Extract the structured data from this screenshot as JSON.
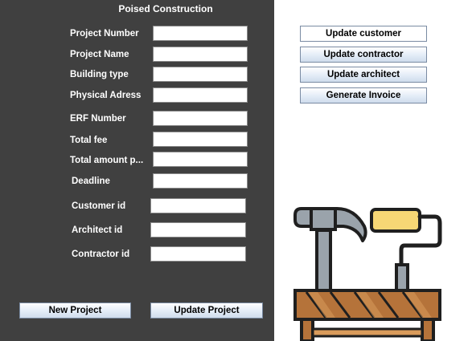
{
  "app": {
    "title": "Poised Construction"
  },
  "form": {
    "fields": [
      {
        "label": "Project Number",
        "value": ""
      },
      {
        "label": "Project Name",
        "value": ""
      },
      {
        "label": "Building type",
        "value": ""
      },
      {
        "label": "Physical Adress",
        "value": ""
      },
      {
        "label": "ERF Number",
        "value": ""
      },
      {
        "label": "Total fee",
        "value": ""
      },
      {
        "label": "Total amount p...",
        "value": ""
      },
      {
        "label": "Deadline",
        "value": ""
      },
      {
        "label": "Customer id",
        "value": ""
      },
      {
        "label": "Architect id",
        "value": ""
      },
      {
        "label": "Contractor id",
        "value": ""
      }
    ]
  },
  "actions": {
    "update_customer": "Update customer",
    "update_contractor": "Update contractor",
    "update_architect": "Update  architect",
    "generate_invoice": "Generate Invoice",
    "new_project": "New Project",
    "update_project": "Update Project"
  },
  "illustration": {
    "icon": "construction-tools-icon",
    "colors": {
      "outline": "#1f1f1f",
      "metal": "#9aa3ab",
      "roller": "#f7d775",
      "wood": "#b5733a",
      "wood_light": "#d99b5b"
    }
  }
}
